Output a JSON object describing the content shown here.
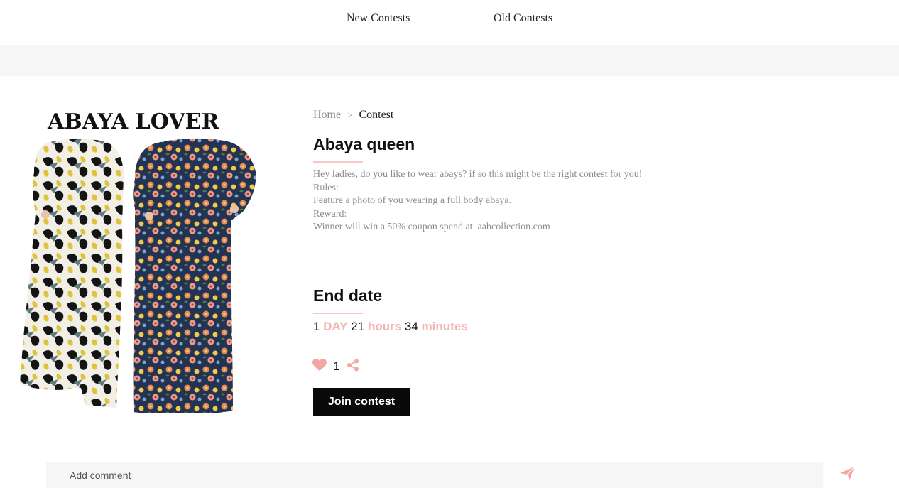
{
  "nav": {
    "new_contests": "New Contests",
    "old_contests": "Old Contests"
  },
  "product_image": {
    "heading": "ABAYA LOVER"
  },
  "breadcrumb": {
    "home": "Home",
    "separator": ">",
    "current": "Contest"
  },
  "contest": {
    "title": "Abaya queen",
    "description_lines": [
      "Hey ladies, do you like to wear abays? if so this might be the right contest for you!",
      "Rules:",
      "Feature a photo of you wearing a full body abaya.",
      "Reward:",
      "Winner will win a 50% coupon spend at  aabcollection.com"
    ]
  },
  "end_date": {
    "title": "End date",
    "days": "1",
    "days_label": "DAY",
    "hours": "21",
    "hours_label": "hours",
    "minutes": "34",
    "minutes_label": "minutes"
  },
  "likes": {
    "count": "1",
    "icon": "heart-icon",
    "share_icon": "share-icon"
  },
  "join_button": "Join contest",
  "comment": {
    "placeholder": "Add comment",
    "send_icon": "send-icon"
  },
  "colors": {
    "accent_pink": "#f4b4b0",
    "button_black": "#0a0a0a",
    "band_grey": "#f6f6f6"
  }
}
